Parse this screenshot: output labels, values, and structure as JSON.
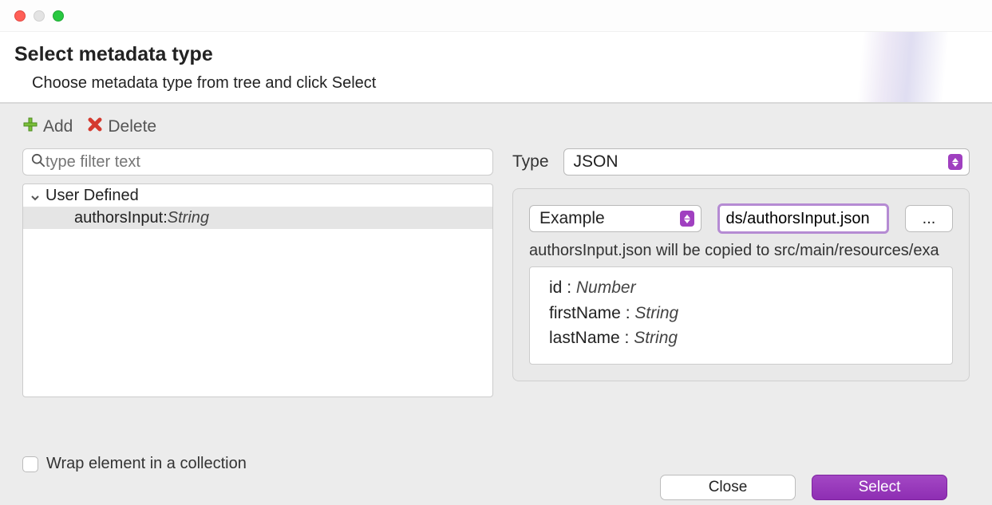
{
  "header": {
    "title": "Select metadata type",
    "subtitle": "Choose metadata type from tree and click Select"
  },
  "toolbar": {
    "add_label": "Add",
    "delete_label": "Delete"
  },
  "filter": {
    "placeholder": "type filter text"
  },
  "tree": {
    "root_label": "User Defined",
    "item_name": "authorsInput",
    "item_sep": " : ",
    "item_type": "String"
  },
  "rightPanel": {
    "type_label": "Type",
    "type_value": "JSON",
    "example_label": "Example",
    "path_value": "ds/authorsInput.json",
    "browse_label": "...",
    "copy_message": "authorsInput.json will be copied to src/main/resources/exa",
    "props": [
      {
        "name": "id",
        "type": "Number"
      },
      {
        "name": "firstName",
        "type": "String"
      },
      {
        "name": "lastName",
        "type": "String"
      }
    ]
  },
  "wrap": {
    "label": "Wrap element in a collection"
  },
  "footer": {
    "close_label": "Close",
    "select_label": "Select"
  }
}
